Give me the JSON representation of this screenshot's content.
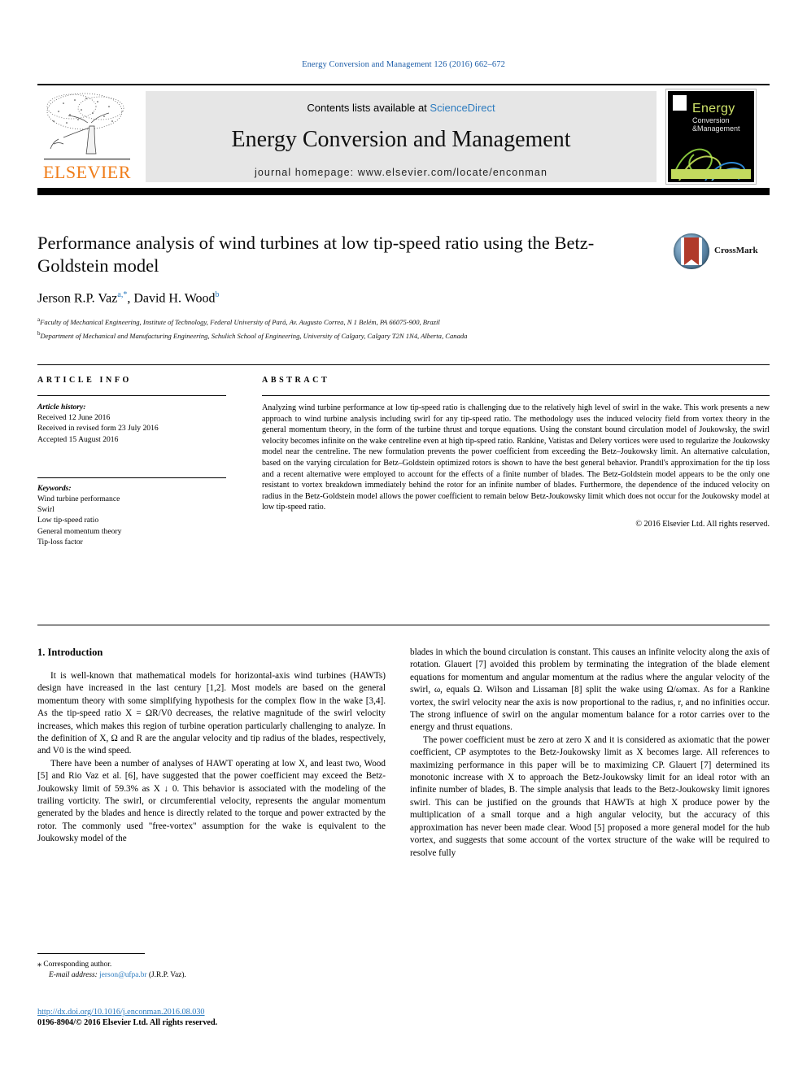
{
  "running_head": "Energy Conversion and Management 126 (2016) 662–672",
  "masthead": {
    "contents_prefix": "Contents lists available at",
    "contents_link": "ScienceDirect",
    "journal_title": "Energy Conversion and Management",
    "homepage": "journal homepage: www.elsevier.com/locate/enconman",
    "publisher_wordmark": "ELSEVIER",
    "cover": {
      "title": "Energy",
      "sub1": "Conversion",
      "sub2": "&Management"
    }
  },
  "article": {
    "title": "Performance analysis of wind turbines at low tip-speed ratio using the Betz-Goldstein model",
    "authors": [
      {
        "name": "Jerson R.P. Vaz",
        "marks": "a,*"
      },
      {
        "name": "David H. Wood",
        "marks": "b"
      }
    ],
    "affiliations": [
      {
        "mark": "a",
        "text": "Faculty of Mechanical Engineering, Institute of Technology, Federal University of Pará, Av. Augusto Correa, N 1 Belém, PA 66075-900, Brazil"
      },
      {
        "mark": "b",
        "text": "Department of Mechanical and Manufacturing Engineering, Schulich School of Engineering, University of Calgary, Calgary T2N 1N4, Alberta, Canada"
      }
    ],
    "crossmark_label": "CrossMark"
  },
  "article_info": {
    "heading": "ARTICLE INFO",
    "history_label": "Article history:",
    "history": [
      "Received 12 June 2016",
      "Received in revised form 23 July 2016",
      "Accepted 15 August 2016"
    ],
    "keywords_label": "Keywords:",
    "keywords": [
      "Wind turbine performance",
      "Swirl",
      "Low tip-speed ratio",
      "General momentum theory",
      "Tip-loss factor"
    ]
  },
  "abstract": {
    "heading": "ABSTRACT",
    "text": "Analyzing wind turbine performance at low tip-speed ratio is challenging due to the relatively high level of swirl in the wake. This work presents a new approach to wind turbine analysis including swirl for any tip-speed ratio. The methodology uses the induced velocity field from vortex theory in the general momentum theory, in the form of the turbine thrust and torque equations. Using the constant bound circulation model of Joukowsky, the swirl velocity becomes infinite on the wake centreline even at high tip-speed ratio. Rankine, Vatistas and Delery vortices were used to regularize the Joukowsky model near the centreline. The new formulation prevents the power coefficient from exceeding the Betz–Joukowsky limit. An alternative calculation, based on the varying circulation for Betz–Goldstein optimized rotors is shown to have the best general behavior. Prandtl's approximation for the tip loss and a recent alternative were employed to account for the effects of a finite number of blades. The Betz-Goldstein model appears to be the only one resistant to vortex breakdown immediately behind the rotor for an infinite number of blades. Furthermore, the dependence of the induced velocity on radius in the Betz-Goldstein model allows the power coefficient to remain below Betz-Joukowsky limit which does not occur for the Joukowsky model at low tip-speed ratio.",
    "copyright": "© 2016 Elsevier Ltd. All rights reserved."
  },
  "body": {
    "section_heading": "1. Introduction",
    "left_paragraphs": [
      "It is well-known that mathematical models for horizontal-axis wind turbines (HAWTs) design have increased in the last century [1,2]. Most models are based on the general momentum theory with some simplifying hypothesis for the complex flow in the wake [3,4]. As the tip-speed ratio X = ΩR/V0 decreases, the relative magnitude of the swirl velocity increases, which makes this region of turbine operation particularly challenging to analyze. In the definition of X, Ω and R are the angular velocity and tip radius of the blades, respectively, and V0 is the wind speed.",
      "There have been a number of analyses of HAWT operating at low X, and least two, Wood [5] and Rio Vaz et al. [6], have suggested that the power coefficient may exceed the Betz-Joukowsky limit of 59.3% as X ↓ 0. This behavior is associated with the modeling of the trailing vorticity. The swirl, or circumferential velocity, represents the angular momentum generated by the blades and hence is directly related to the torque and power extracted by the rotor. The commonly used \"free-vortex\" assumption for the wake is equivalent to the Joukowsky model of the"
    ],
    "right_paragraphs": [
      "blades in which the bound circulation is constant. This causes an infinite velocity along the axis of rotation. Glauert [7] avoided this problem by terminating the integration of the blade element equations for momentum and angular momentum at the radius where the angular velocity of the swirl, ω, equals Ω. Wilson and Lissaman [8] split the wake using Ω/ωmax. As for a Rankine vortex, the swirl velocity near the axis is now proportional to the radius, r, and no infinities occur. The strong influence of swirl on the angular momentum balance for a rotor carries over to the energy and thrust equations.",
      "The power coefficient must be zero at zero X and it is considered as axiomatic that the power coefficient, CP asymptotes to the Betz-Joukowsky limit as X becomes large. All references to maximizing performance in this paper will be to maximizing CP. Glauert [7] determined its monotonic increase with X to approach the Betz-Joukowsky limit for an ideal rotor with an infinite number of blades, B. The simple analysis that leads to the Betz-Joukowsky limit ignores swirl. This can be justified on the grounds that HAWTs at high X produce power by the multiplication of a small torque and a high angular velocity, but the accuracy of this approximation has never been made clear. Wood [5] proposed a more general model for the hub vortex, and suggests that some account of the vortex structure of the wake will be required to resolve fully"
    ]
  },
  "footnotes": {
    "corresponding": "Corresponding author.",
    "email_label": "E-mail address:",
    "email": "jerson@ufpa.br",
    "email_suffix": "(J.R.P. Vaz).",
    "doi": "http://dx.doi.org/10.1016/j.enconman.2016.08.030",
    "issn_line": "0196-8904/© 2016 Elsevier Ltd. All rights reserved."
  },
  "colors": {
    "link": "#2c7bbf",
    "elsevier_orange": "#f07d19",
    "cover_green": "#c3da5e"
  }
}
